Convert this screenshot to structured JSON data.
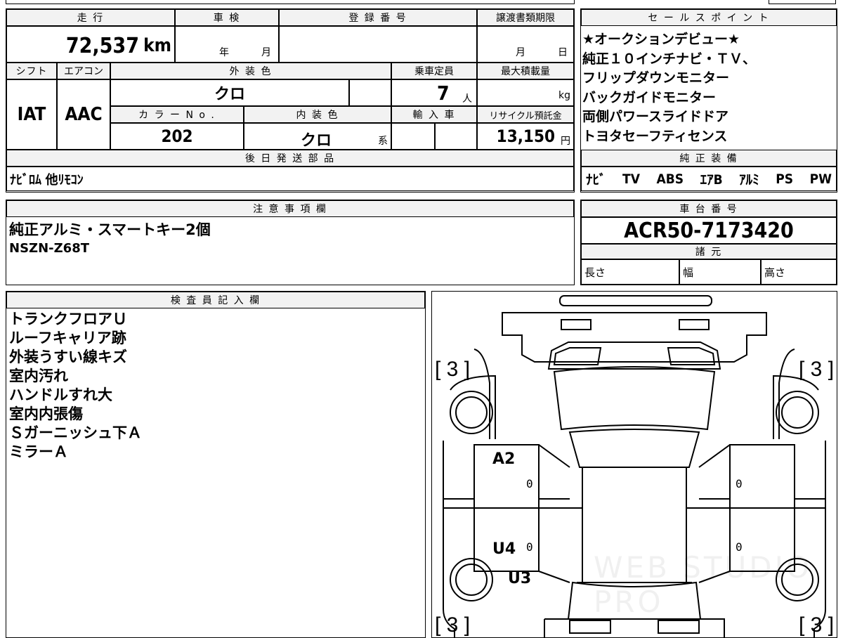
{
  "labels": {
    "mileage": "走 行",
    "shaken": "車 検",
    "registration_no": "登 録 番 号",
    "transfer_deadline": "譲渡書類期限",
    "sales_points": "セ ー ル ス ポ イ ン ト",
    "shift": "シフト",
    "aircon": "エアコン",
    "exterior_color": "外 装 色",
    "capacity": "乗車定員",
    "max_load": "最大積載量",
    "color_no": "カ ラ ー N o .",
    "interior_color": "内 装 色",
    "import": "輸 入 車",
    "recycle": "リサイクル預託金",
    "later_parts": "後 日 発 送 部 品",
    "genuine_equipment": "純 正 装 備",
    "notes": "注 意 事 項 欄",
    "chassis_no": "車 台 番 号",
    "specs": "諸 元",
    "length": "長さ",
    "width": "幅",
    "height": "高さ",
    "inspector": "検 査 員 記 入 欄",
    "year": "年",
    "month": "月",
    "deadline_month": "月",
    "deadline_day": "日",
    "person": "人",
    "kg": "kg",
    "interior_suffix": "系",
    "yen": "円"
  },
  "values": {
    "mileage": "72,537",
    "mileage_unit": "km",
    "shift": "IAT",
    "aircon": "AAC",
    "exterior_color": "クロ",
    "capacity": "7",
    "color_no": "202",
    "interior_color": "クロ",
    "recycle": "13,150",
    "later_parts": "ﾅﾋﾞﾛﾑ 他ﾘﾓｺﾝ",
    "chassis_no": "ACR50-7173420"
  },
  "sales_points": [
    "★オークションデビュー★",
    "純正１０インチナビ・ＴＶ、",
    "フリップダウンモニター",
    "バックガイドモニター",
    "両側パワースライドドア",
    "トヨタセーフティセンス"
  ],
  "genuine_equipment": [
    "ﾅﾋﾞ",
    "TV",
    "ABS",
    "ｴｱB",
    "ｱﾙﾐ",
    "PS",
    "PW"
  ],
  "notes": [
    "純正アルミ・スマートキー2個",
    "NSZN-Z68T"
  ],
  "inspector_notes": [
    "トランクフロアＵ",
    "ルーフキャリア跡",
    "外装うすい線キズ",
    "室内汚れ",
    "ハンドルすれ大",
    "室内内張傷",
    "Ｓガーニッシュ下Ａ",
    "ミラーＡ"
  ],
  "diagram": {
    "seals": [
      "[ 3 ]",
      "[ 3 ]",
      "[ 3 ]",
      "[ 3 ]"
    ],
    "damage": [
      "A2",
      "U4",
      "U3"
    ],
    "zeros": [
      "0",
      "0",
      "0",
      "0"
    ],
    "watermark": "WEB STUDIO PRO"
  }
}
